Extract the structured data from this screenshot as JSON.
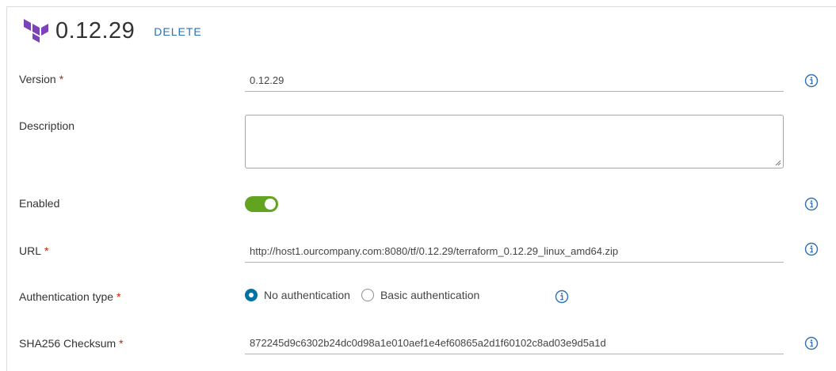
{
  "header": {
    "title": "0.12.29",
    "delete_label": "DELETE",
    "logo_icon": "terraform-logo"
  },
  "form": {
    "version": {
      "label": "Version",
      "required": "*",
      "value": "0.12.29"
    },
    "description": {
      "label": "Description",
      "value": ""
    },
    "enabled": {
      "label": "Enabled",
      "on": true
    },
    "url": {
      "label": "URL",
      "required": "*",
      "value": "http://host1.ourcompany.com:8080/tf/0.12.29/terraform_0.12.29_linux_amd64.zip"
    },
    "auth_type": {
      "label": "Authentication type",
      "required": "*",
      "options": [
        "No authentication",
        "Basic authentication"
      ],
      "selected": "No authentication"
    },
    "checksum": {
      "label": "SHA256 Checksum",
      "required": "*",
      "value": "872245d9c6302b24dc0d98a1e010aef1e4ef60865a2d1f60102c8ad03e9d5a1d"
    }
  },
  "colors": {
    "accent": "#0072a3",
    "link": "#2c6fb3",
    "toggle_on": "#62a420",
    "required": "#c92100",
    "logo": "#7b42bc"
  }
}
